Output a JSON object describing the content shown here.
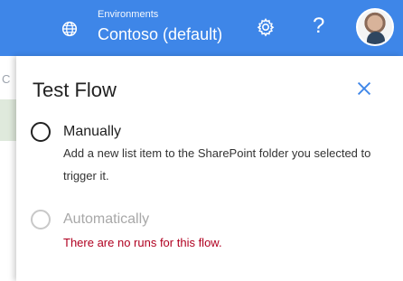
{
  "header": {
    "environment_caption": "Environments",
    "environment_name": "Contoso (default)",
    "icons": {
      "environment": "globe-icon",
      "settings": "gear-icon",
      "help": "help-icon",
      "avatar": "user-avatar"
    },
    "help_glyph": "?",
    "colors": {
      "bar": "#3e86e8",
      "text": "#ffffff"
    }
  },
  "sidebar": {
    "partial_char": "C"
  },
  "panel": {
    "title": "Test Flow",
    "close_icon": "close-icon",
    "options": [
      {
        "label": "Manually",
        "description": "Add a new list item to the SharePoint folder you selected to trigger it.",
        "enabled": true
      },
      {
        "label": "Automatically",
        "error": "There are no runs for this flow.",
        "enabled": false
      }
    ],
    "colors": {
      "error": "#b00020",
      "disabled": "#a8a8a8",
      "accent": "#3e86e8"
    }
  }
}
